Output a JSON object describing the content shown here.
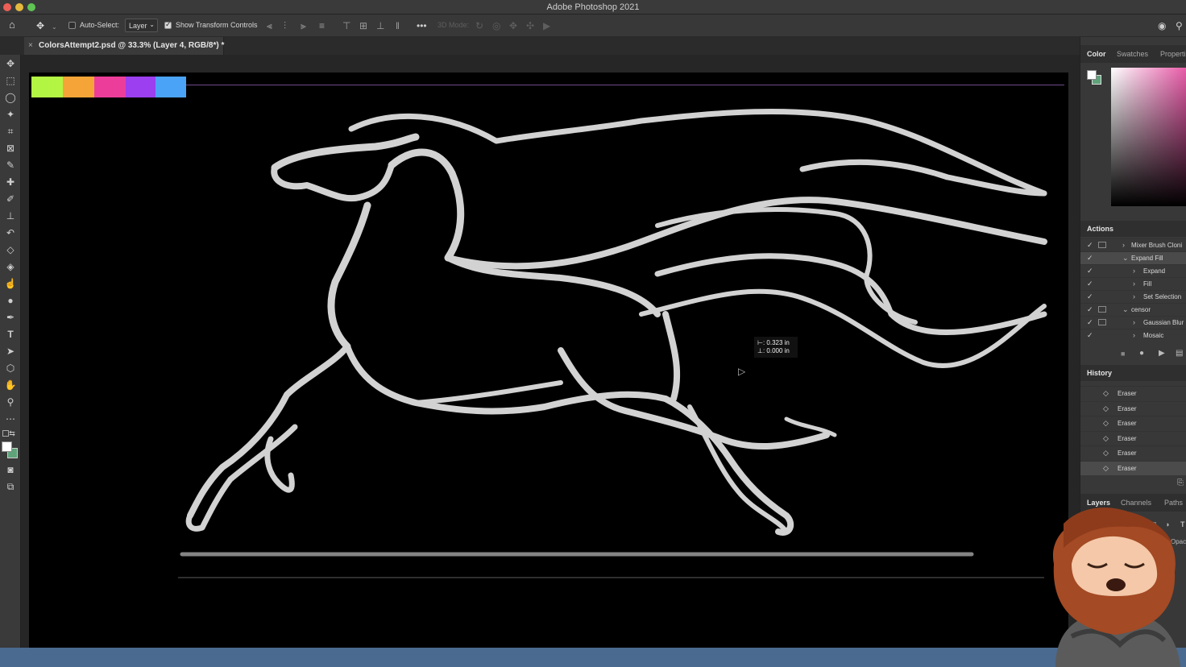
{
  "app": {
    "window_title": "Adobe Photoshop 2021"
  },
  "options_bar": {
    "auto_select_label": "Auto-Select:",
    "auto_select_value": "Layer",
    "show_transform_label": "Show Transform Controls",
    "mode_3d_label": "3D Mode:"
  },
  "document": {
    "tab_title": "ColorsAttempt2.psd @ 33.3% (Layer 4, RGB/8*) *",
    "close_glyph": "×"
  },
  "canvas": {
    "swatch_colors": [
      "#b3f543",
      "#f5a537",
      "#ec3d9b",
      "#9b3ff0",
      "#4aa3f7"
    ],
    "measure_line1": "⊢: 0.323 in",
    "measure_line2": "⊥: 0.000 in"
  },
  "panels": {
    "color_tabs": [
      "Color",
      "Swatches",
      "Properti"
    ],
    "actions_title": "Actions",
    "actions": [
      {
        "label": "Mixer Brush Cloni",
        "level": 0,
        "expanded": false,
        "dialog": true
      },
      {
        "label": "Expand Fill",
        "level": 0,
        "expanded": true,
        "dialog": false,
        "selected": true
      },
      {
        "label": "Expand",
        "level": 1,
        "expanded": false,
        "dialog": false
      },
      {
        "label": "Fill",
        "level": 1,
        "expanded": false,
        "dialog": false
      },
      {
        "label": "Set Selection",
        "level": 1,
        "expanded": false,
        "dialog": false
      },
      {
        "label": "censor",
        "level": 0,
        "expanded": true,
        "dialog": true
      },
      {
        "label": "Gaussian Blur",
        "level": 1,
        "expanded": false,
        "dialog": true
      },
      {
        "label": "Mosaic",
        "level": 1,
        "expanded": false,
        "dialog": false
      }
    ],
    "history_title": "History",
    "history": [
      "Eraser",
      "Eraser",
      "Eraser",
      "Eraser",
      "Eraser",
      "Eraser"
    ],
    "layer_tabs": [
      "Layers",
      "Channels",
      "Paths"
    ],
    "layers_opacity_label": "Opac"
  },
  "colors": {
    "foreground": "#ffffff",
    "background": "#5fa37a",
    "footer": "#4a6a90"
  }
}
